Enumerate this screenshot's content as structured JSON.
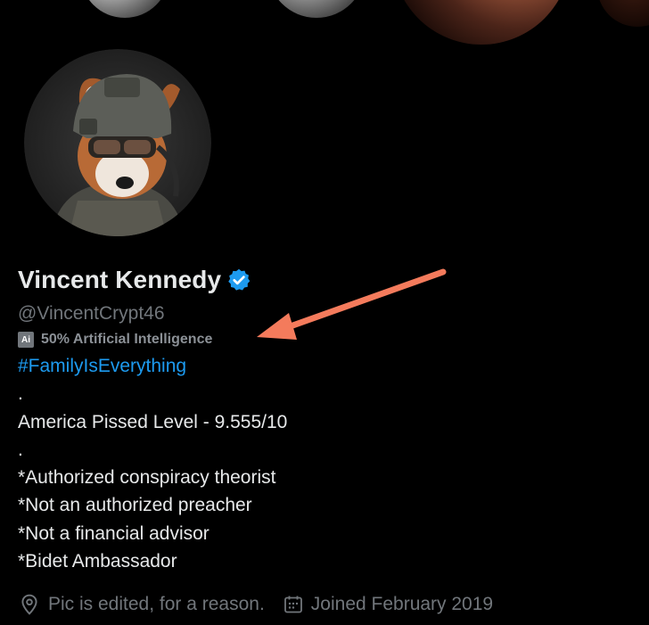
{
  "banner": {
    "icon": "lunar-eclipse-banner"
  },
  "profile": {
    "avatar_icon": "red-panda-soldier-avatar",
    "name": "Vincent Kennedy",
    "verified_icon": "verified-badge-icon",
    "verified_color": "#1d9bf0",
    "handle": "@VincentCrypt46",
    "automation_badge": "Ai",
    "automation_label": "50% Artificial Intelligence",
    "bio": {
      "hashtag": "#FamilyIsEverything",
      "lines": [
        ".",
        "America Pissed Level - 9.555/10",
        ".",
        "*Authorized conspiracy theorist",
        "*Not an authorized preacher",
        "*Not a financial advisor",
        "*Bidet Ambassador"
      ]
    },
    "location_icon": "location-pin-icon",
    "location": "Pic is edited, for a reason.",
    "joined_icon": "calendar-icon",
    "joined": "Joined February 2019"
  },
  "annotation": {
    "arrow_color": "#f47b5c",
    "icon": "annotation-arrow"
  }
}
